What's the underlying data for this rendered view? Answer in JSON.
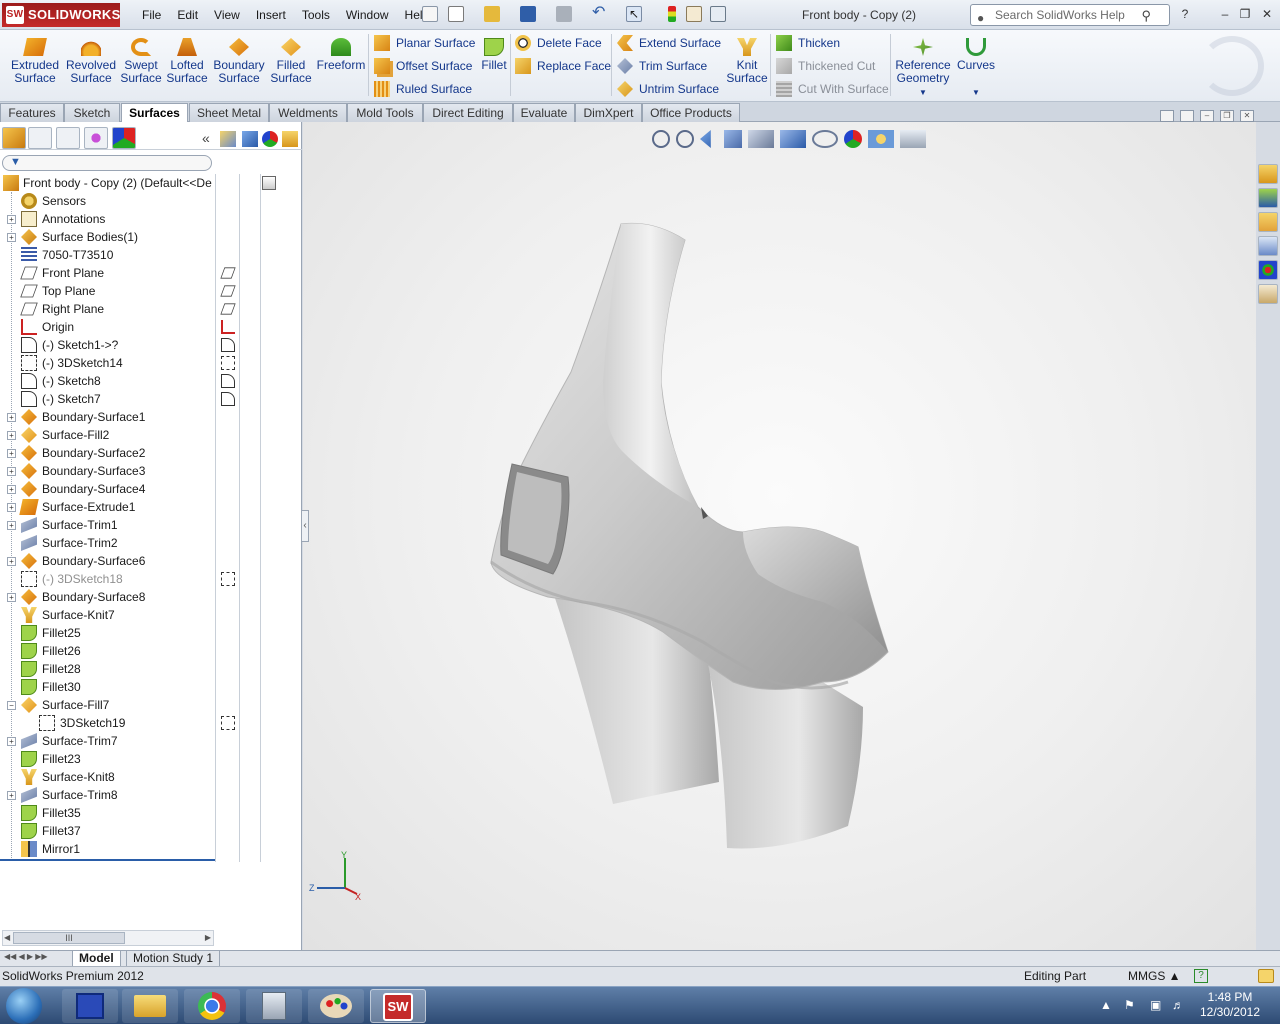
{
  "app": {
    "brand": "SOLIDWORKS",
    "menus": [
      "File",
      "Edit",
      "View",
      "Insert",
      "Tools",
      "Window",
      "Help"
    ],
    "document_title": "Front body - Copy (2)",
    "search_placeholder": "Search SolidWorks Help",
    "help_label": "?"
  },
  "ribbon": {
    "big_buttons": [
      {
        "id": "extruded",
        "line1": "Extruded",
        "line2": "Surface",
        "icon": "extruded-surface-icon"
      },
      {
        "id": "revolved",
        "line1": "Revolved",
        "line2": "Surface",
        "icon": "revolved-surface-icon"
      },
      {
        "id": "swept",
        "line1": "Swept",
        "line2": "Surface",
        "icon": "swept-surface-icon"
      },
      {
        "id": "lofted",
        "line1": "Lofted",
        "line2": "Surface",
        "icon": "lofted-surface-icon"
      },
      {
        "id": "boundary",
        "line1": "Boundary",
        "line2": "Surface",
        "icon": "boundary-surface-icon"
      },
      {
        "id": "filled",
        "line1": "Filled",
        "line2": "Surface",
        "icon": "filled-surface-icon"
      },
      {
        "id": "freeform",
        "line1": "Freeform",
        "line2": "",
        "icon": "freeform-icon"
      }
    ],
    "col1": [
      "Planar Surface",
      "Offset Surface",
      "Ruled Surface"
    ],
    "fillet": "Fillet",
    "col2": [
      "Delete Face",
      "Replace Face"
    ],
    "col3": [
      "Extend Surface",
      "Trim Surface",
      "Untrim Surface"
    ],
    "knit": {
      "line1": "Knit",
      "line2": "Surface"
    },
    "col4": [
      "Thicken",
      "Thickened Cut",
      "Cut With Surface"
    ],
    "reference": {
      "line1": "Reference",
      "line2": "Geometry"
    },
    "curves": "Curves"
  },
  "tabs": [
    "Features",
    "Sketch",
    "Surfaces",
    "Sheet Metal",
    "Weldments",
    "Mold Tools",
    "Direct Editing",
    "Evaluate",
    "DimXpert",
    "Office Products"
  ],
  "active_tab": "Surfaces",
  "tree": {
    "root": "Front body - Copy (2)  (Default<<De",
    "items": [
      {
        "label": "Sensors",
        "icon": "sensor-icon",
        "expander": false,
        "side": ""
      },
      {
        "label": "Annotations",
        "icon": "annotations-icon",
        "expander": true,
        "side": ""
      },
      {
        "label": "Surface Bodies(1)",
        "icon": "surface-bodies-icon",
        "expander": true,
        "side": ""
      },
      {
        "label": "7050-T73510",
        "icon": "material-icon",
        "expander": false,
        "side": ""
      },
      {
        "label": "Front Plane",
        "icon": "plane-icon",
        "expander": false,
        "side": "plane-icon"
      },
      {
        "label": "Top Plane",
        "icon": "plane-icon",
        "expander": false,
        "side": "plane-icon"
      },
      {
        "label": "Right Plane",
        "icon": "plane-icon",
        "expander": false,
        "side": "plane-icon"
      },
      {
        "label": "Origin",
        "icon": "origin-icon",
        "expander": false,
        "side": "origin-icon"
      },
      {
        "label": "(-) Sketch1->?",
        "icon": "sketch-icon",
        "expander": false,
        "side": "sketch-icon"
      },
      {
        "label": "(-) 3DSketch14",
        "icon": "3dsketch-icon",
        "expander": false,
        "side": "3dsketch-icon"
      },
      {
        "label": "(-) Sketch8",
        "icon": "sketch-icon",
        "expander": false,
        "side": "sketch-icon"
      },
      {
        "label": "(-) Sketch7",
        "icon": "sketch-icon",
        "expander": false,
        "side": "sketch-icon"
      },
      {
        "label": "Boundary-Surface1",
        "icon": "boundary-surface-icon",
        "expander": true,
        "side": ""
      },
      {
        "label": "Surface-Fill2",
        "icon": "surface-fill-icon",
        "expander": true,
        "side": ""
      },
      {
        "label": "Boundary-Surface2",
        "icon": "boundary-surface-icon",
        "expander": true,
        "side": ""
      },
      {
        "label": "Boundary-Surface3",
        "icon": "boundary-surface-icon",
        "expander": true,
        "side": ""
      },
      {
        "label": "Boundary-Surface4",
        "icon": "boundary-surface-icon",
        "expander": true,
        "side": ""
      },
      {
        "label": "Surface-Extrude1",
        "icon": "surface-extrude-icon",
        "expander": true,
        "side": ""
      },
      {
        "label": "Surface-Trim1",
        "icon": "surface-trim-icon",
        "expander": true,
        "side": ""
      },
      {
        "label": "Surface-Trim2",
        "icon": "surface-trim-icon",
        "expander": false,
        "side": ""
      },
      {
        "label": "Boundary-Surface6",
        "icon": "boundary-surface-icon",
        "expander": true,
        "side": ""
      },
      {
        "label": "(-) 3DSketch18",
        "icon": "3dsketch-icon",
        "expander": false,
        "side": "3dsketch-icon",
        "grey": true
      },
      {
        "label": "Boundary-Surface8",
        "icon": "boundary-surface-icon",
        "expander": true,
        "side": ""
      },
      {
        "label": "Surface-Knit7",
        "icon": "surface-knit-icon",
        "expander": false,
        "side": ""
      },
      {
        "label": "Fillet25",
        "icon": "fillet-icon",
        "expander": false,
        "side": ""
      },
      {
        "label": "Fillet26",
        "icon": "fillet-icon",
        "expander": false,
        "side": ""
      },
      {
        "label": "Fillet28",
        "icon": "fillet-icon",
        "expander": false,
        "side": ""
      },
      {
        "label": "Fillet30",
        "icon": "fillet-icon",
        "expander": false,
        "side": ""
      },
      {
        "label": "Surface-Fill7",
        "icon": "surface-fill-icon",
        "expander": true,
        "expanded": true,
        "side": ""
      },
      {
        "label": "3DSketch19",
        "icon": "3dsketch-icon",
        "expander": false,
        "side": "3dsketch-icon",
        "child": true
      },
      {
        "label": "Surface-Trim7",
        "icon": "surface-trim-icon",
        "expander": true,
        "side": ""
      },
      {
        "label": "Fillet23",
        "icon": "fillet-icon",
        "expander": false,
        "side": ""
      },
      {
        "label": "Surface-Knit8",
        "icon": "surface-knit-icon",
        "expander": false,
        "side": ""
      },
      {
        "label": "Surface-Trim8",
        "icon": "surface-trim-icon",
        "expander": true,
        "side": ""
      },
      {
        "label": "Fillet35",
        "icon": "fillet-icon",
        "expander": false,
        "side": ""
      },
      {
        "label": "Fillet37",
        "icon": "fillet-icon",
        "expander": false,
        "side": ""
      },
      {
        "label": "Mirror1",
        "icon": "mirror-icon",
        "expander": false,
        "side": ""
      }
    ]
  },
  "scroll_thumb": "III",
  "bottom_tabs": [
    "Model",
    "Motion Study 1"
  ],
  "status": {
    "left": "SolidWorks Premium 2012",
    "mode": "Editing Part",
    "units": "MMGS"
  },
  "triad": {
    "x": "X",
    "y": "Y",
    "z": "Z"
  },
  "clock": {
    "time": "1:48 PM",
    "date": "12/30/2012"
  },
  "colors": {
    "brand_red": "#b22222",
    "label_blue": "#14378b",
    "model_grey": "#c9c9c9"
  }
}
